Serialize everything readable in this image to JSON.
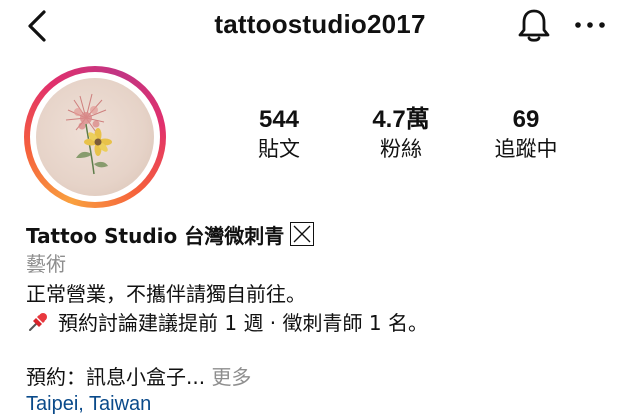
{
  "header": {
    "username": "tattoostudio2017",
    "back_icon": "chevron-left-icon",
    "bell_icon": "bell-icon",
    "more_icon": "more-horizontal-icon"
  },
  "profile": {
    "avatar_icon": "flower-tattoo-avatar",
    "stats": [
      {
        "value": "544",
        "label": "貼文"
      },
      {
        "value": "4.7萬",
        "label": "粉絲"
      },
      {
        "value": "69",
        "label": "追蹤中"
      }
    ]
  },
  "bio": {
    "name": "Tattoo Studio 台灣微刺青",
    "verify_icon": "boxed-x-icon",
    "category": "藝術",
    "line1": "正常營業，不攜伴請獨自前往。",
    "line2_icon": "pushpin-icon",
    "line2": "預約討論建議提前 1 週 · 徵刺青師 1 名。",
    "line3": "預約：訊息小盒子...",
    "more_label": "更多",
    "location": "Taipei, Taiwan"
  },
  "colors": {
    "text": "#111111",
    "muted": "#8e8e8e",
    "link": "#0a4a8a",
    "ring_gradient": [
      "#f9a03f",
      "#f55f3c",
      "#e1306c",
      "#c13584"
    ]
  }
}
